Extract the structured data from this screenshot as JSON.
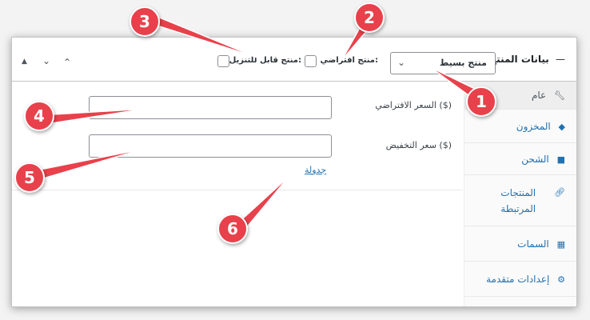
{
  "header": {
    "title": "بيانات المنتج",
    "title_dash": "—",
    "product_type": {
      "selected": "منتج بسيط"
    },
    "virtual_label": "منتج افتراضي:",
    "downloadable_label": "منتج قابل للتنزيل:"
  },
  "toolbar": {
    "up_label": "▲",
    "down_label": "▾",
    "up2_label": "▴"
  },
  "tabs": [
    {
      "label": "عام",
      "icon": "wrench-icon"
    },
    {
      "label": "المخزون",
      "icon": "tag-icon"
    },
    {
      "label": "الشحن",
      "icon": "truck-icon"
    },
    {
      "label": "المنتجات المرتبطة",
      "icon": "link-icon"
    },
    {
      "label": "السمات",
      "icon": "table-icon"
    },
    {
      "label": "إعدادات متقدمة",
      "icon": "gear-icon"
    }
  ],
  "general": {
    "regular_price_label": "السعر الافتراضي ($)",
    "sale_price_label": "سعر التخفيض ($)",
    "schedule_link": "جدولة",
    "regular_price_value": "",
    "sale_price_value": ""
  },
  "callouts": [
    "1",
    "2",
    "3",
    "4",
    "5",
    "6"
  ],
  "colors": {
    "accent": "#2271b1",
    "callout": "#e8414b"
  }
}
